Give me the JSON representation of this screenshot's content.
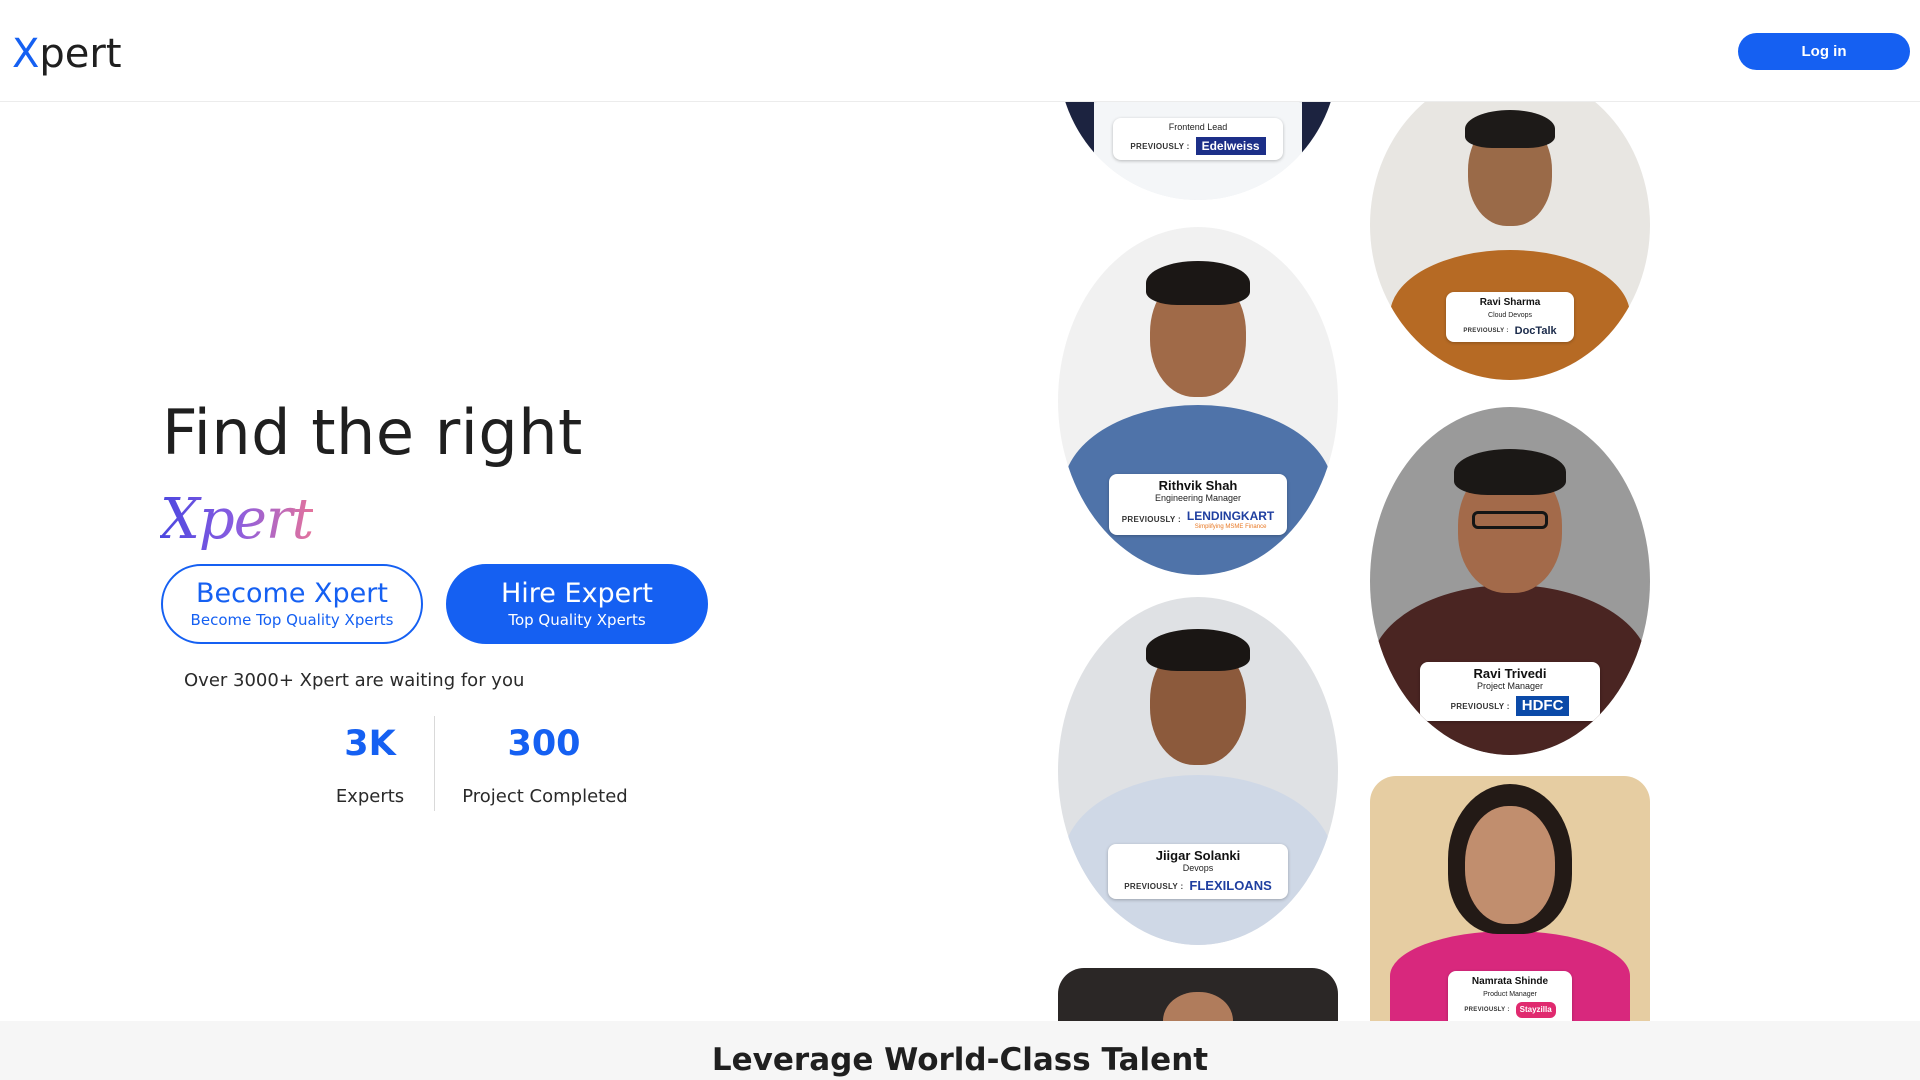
{
  "header": {
    "logo_x": "X",
    "logo_rest": "pert",
    "login_label": "Log in"
  },
  "hero": {
    "title": "Find the right",
    "brand": "Xpert",
    "become_label": "Become Xpert",
    "become_sub": "Become Top Quality Xperts",
    "hire_label": "Hire Expert",
    "hire_sub": "Top Quality Xperts",
    "waiting_text": "Over 3000+ Xpert are waiting for you"
  },
  "stats": [
    {
      "value": "3K",
      "label": "Experts"
    },
    {
      "value": "300",
      "label": "Project Completed"
    }
  ],
  "profiles": {
    "previously_label": "PREVIOUSLY :",
    "items": [
      {
        "name": "",
        "role": "Frontend Lead",
        "company": "Edelweiss",
        "company_color": "#ffffff"
      },
      {
        "name": "Ravi Sharma",
        "role": "Cloud Devops",
        "company": "DocTalk",
        "company_color": "#1a2a4a"
      },
      {
        "name": "Rithvik Shah",
        "role": "Engineering Manager",
        "company": "LENDINGKART",
        "company_color": "#1f3fa0",
        "company_sub": "Simplifying MSME Finance"
      },
      {
        "name": "Ravi Trivedi",
        "role": "Project Manager",
        "company": "HDFC",
        "company_color": "#ffffff"
      },
      {
        "name": "Jiigar Solanki",
        "role": "Devops",
        "company": "FLEXILOANS",
        "company_color": "#1f3fa0"
      },
      {
        "name": "Namrata Shinde",
        "role": "Product Manager",
        "company": "Stayzilla",
        "company_color": "#ffffff"
      }
    ]
  },
  "band": {
    "title": "Leverage World-Class Talent"
  },
  "colors": {
    "accent": "#1560f2",
    "brand_gradient_start": "#4b47e0",
    "brand_gradient_end": "#e4739c"
  }
}
